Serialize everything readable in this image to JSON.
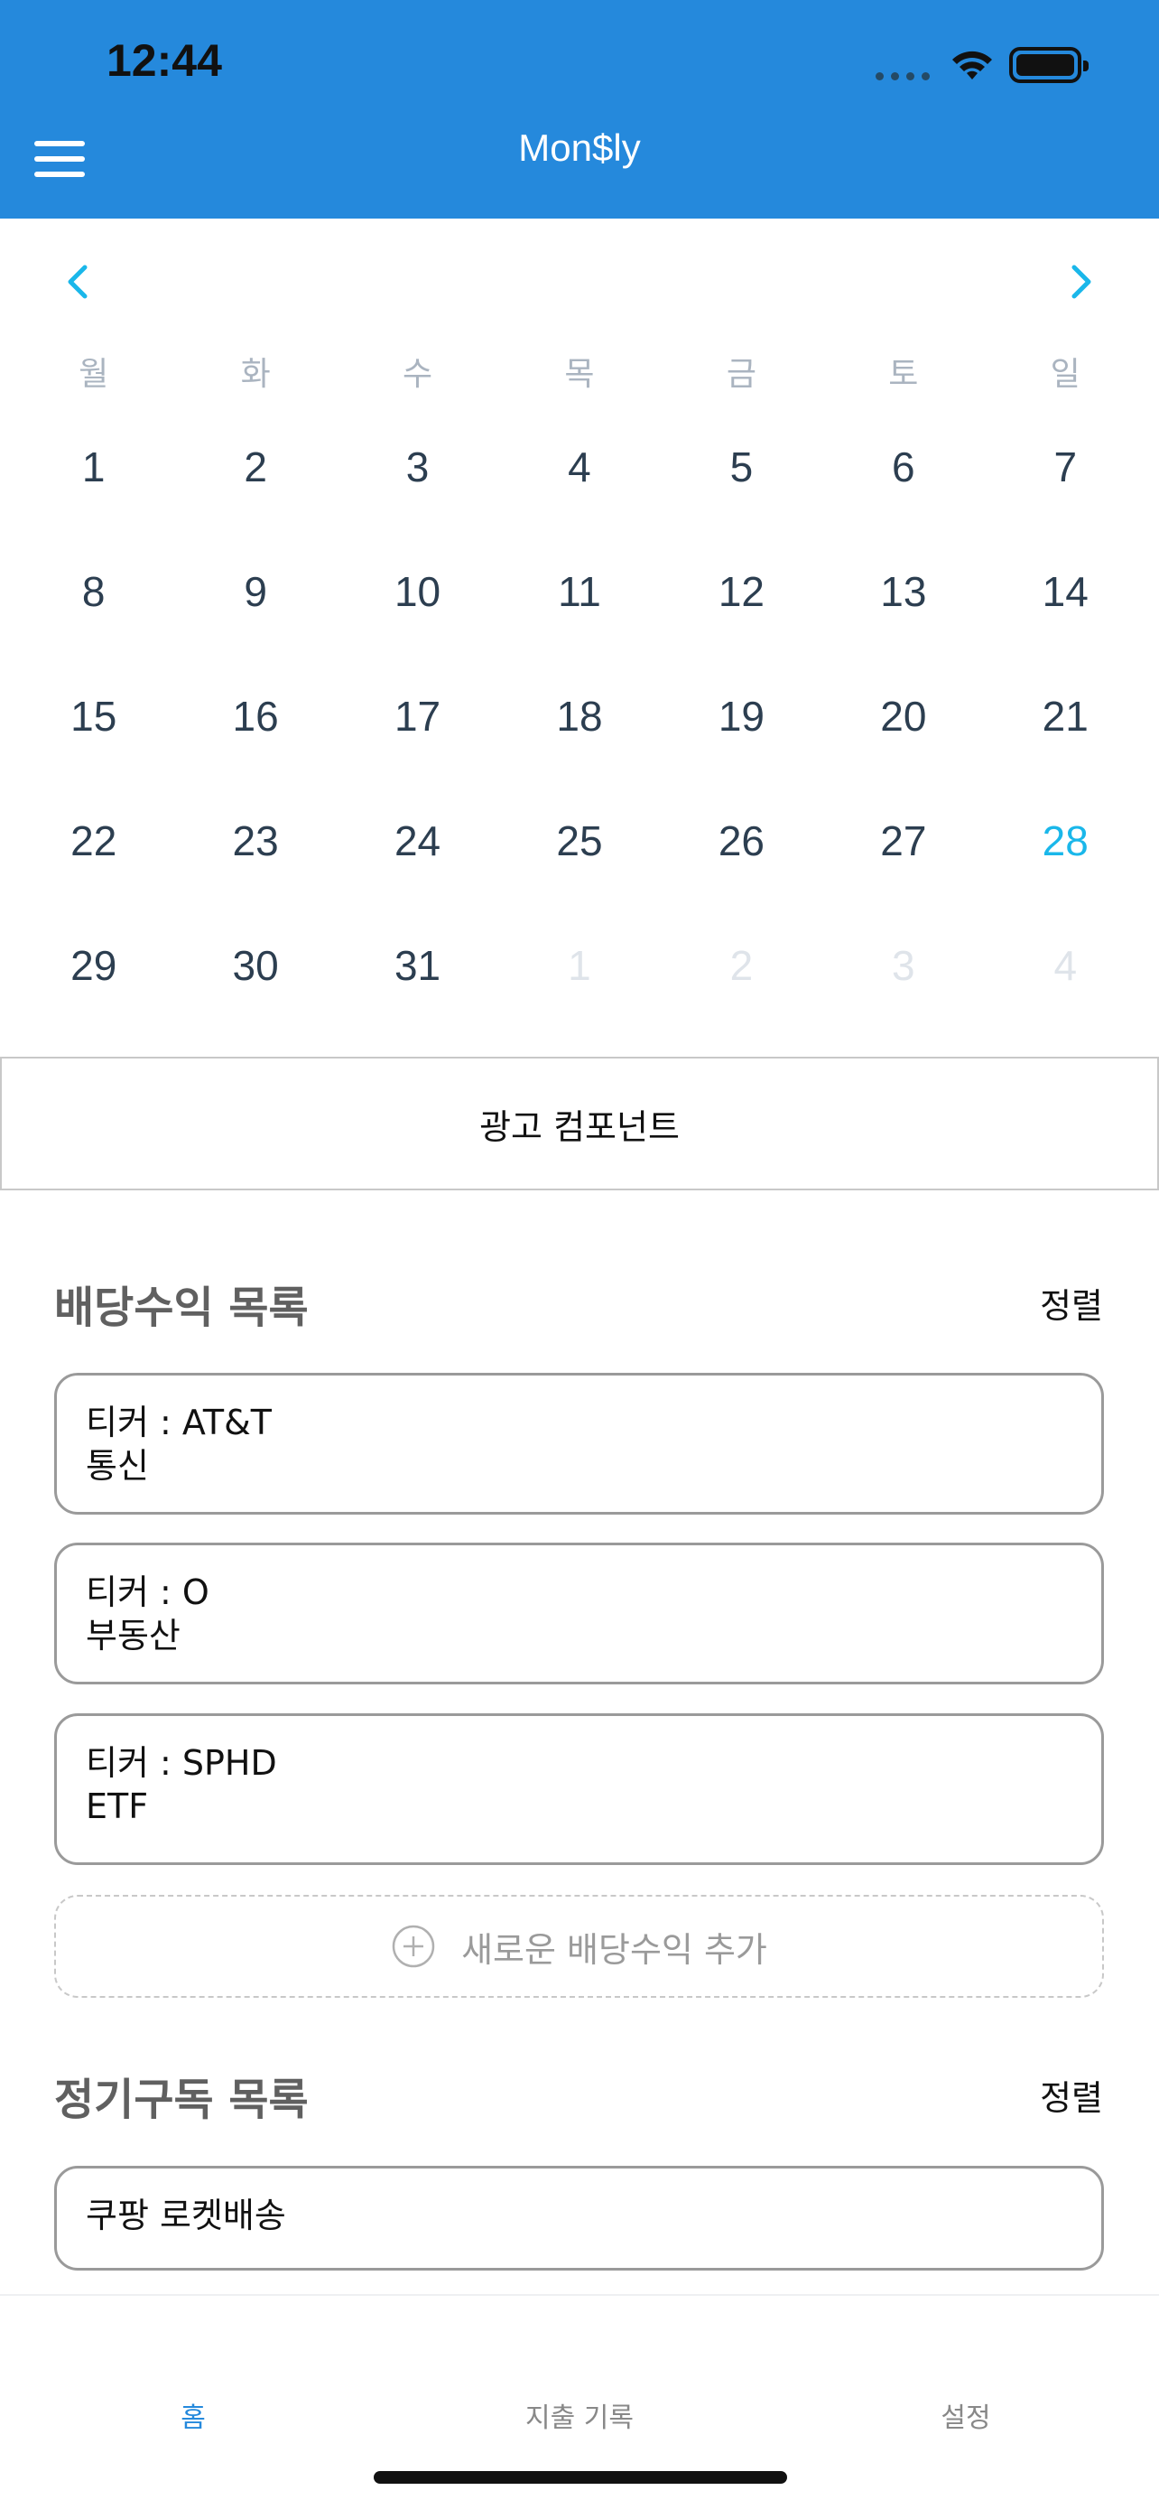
{
  "status_bar": {
    "time": "12:44"
  },
  "header": {
    "title": "Mon$ly"
  },
  "calendar": {
    "weekdays": [
      "월",
      "화",
      "수",
      "목",
      "금",
      "토",
      "일"
    ],
    "days": [
      {
        "label": "1",
        "state": "current"
      },
      {
        "label": "2",
        "state": "current"
      },
      {
        "label": "3",
        "state": "current"
      },
      {
        "label": "4",
        "state": "current"
      },
      {
        "label": "5",
        "state": "current"
      },
      {
        "label": "6",
        "state": "current"
      },
      {
        "label": "7",
        "state": "current"
      },
      {
        "label": "8",
        "state": "current"
      },
      {
        "label": "9",
        "state": "current"
      },
      {
        "label": "10",
        "state": "current"
      },
      {
        "label": "11",
        "state": "current"
      },
      {
        "label": "12",
        "state": "current"
      },
      {
        "label": "13",
        "state": "current"
      },
      {
        "label": "14",
        "state": "current"
      },
      {
        "label": "15",
        "state": "current"
      },
      {
        "label": "16",
        "state": "current"
      },
      {
        "label": "17",
        "state": "current"
      },
      {
        "label": "18",
        "state": "current"
      },
      {
        "label": "19",
        "state": "current"
      },
      {
        "label": "20",
        "state": "current"
      },
      {
        "label": "21",
        "state": "current"
      },
      {
        "label": "22",
        "state": "current"
      },
      {
        "label": "23",
        "state": "current"
      },
      {
        "label": "24",
        "state": "current"
      },
      {
        "label": "25",
        "state": "current"
      },
      {
        "label": "26",
        "state": "current"
      },
      {
        "label": "27",
        "state": "current"
      },
      {
        "label": "28",
        "state": "today"
      },
      {
        "label": "29",
        "state": "current"
      },
      {
        "label": "30",
        "state": "current"
      },
      {
        "label": "31",
        "state": "current"
      },
      {
        "label": "1",
        "state": "other"
      },
      {
        "label": "2",
        "state": "other"
      },
      {
        "label": "3",
        "state": "other"
      },
      {
        "label": "4",
        "state": "other"
      }
    ]
  },
  "ad": {
    "label": "광고 컴포넌트"
  },
  "dividends": {
    "title": "배당수익 목록",
    "sort_label": "정렬",
    "items": [
      {
        "ticker": "티커 : AT&T",
        "sector": "통신"
      },
      {
        "ticker": "티커 : O",
        "sector": "부동산"
      },
      {
        "ticker": "티커 : SPHD",
        "sector": "ETF"
      }
    ],
    "add_label": "새로운 배당수익 추가"
  },
  "subscriptions": {
    "title": "정기구독 목록",
    "sort_label": "정렬",
    "items": [
      {
        "name": "쿠팡 로켓배송"
      }
    ]
  },
  "tabs": [
    {
      "label": "홈",
      "active": true
    },
    {
      "label": "지출 기록",
      "active": false
    },
    {
      "label": "설정",
      "active": false
    }
  ],
  "colors": {
    "header": "#2589dc",
    "accent": "#1ab7ea",
    "today": "#1ab7ea"
  }
}
